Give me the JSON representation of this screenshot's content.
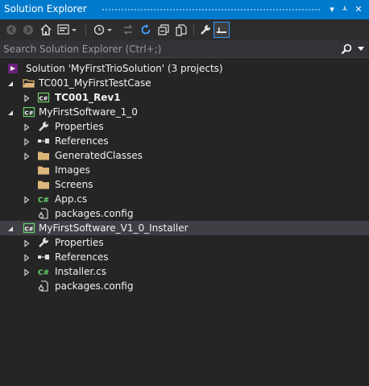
{
  "window": {
    "title": "Solution Explorer"
  },
  "search": {
    "placeholder": "Search Solution Explorer (Ctrl+;)"
  },
  "tree": [
    {
      "label": "Solution 'MyFirstTrioSolution' (3 projects)",
      "icon": "solution-icon",
      "expander": "none"
    },
    {
      "label": "TC001_MyFirstTestCase",
      "icon": "folder-open-icon",
      "expander": "expanded"
    },
    {
      "label": "TC001_Rev1",
      "icon": "csharp-project-icon",
      "expander": "collapsed",
      "bold": true
    },
    {
      "label": "MyFirstSoftware_1_0",
      "icon": "csharp-project-icon",
      "expander": "expanded"
    },
    {
      "label": "Properties",
      "icon": "wrench-icon",
      "expander": "collapsed"
    },
    {
      "label": "References",
      "icon": "references-icon",
      "expander": "collapsed"
    },
    {
      "label": "GeneratedClasses",
      "icon": "folder-icon",
      "expander": "collapsed"
    },
    {
      "label": "Images",
      "icon": "folder-icon",
      "expander": "none"
    },
    {
      "label": "Screens",
      "icon": "folder-icon",
      "expander": "none"
    },
    {
      "label": "App.cs",
      "icon": "csharp-file-icon",
      "expander": "collapsed"
    },
    {
      "label": "packages.config",
      "icon": "config-file-icon",
      "expander": "none"
    },
    {
      "label": "MyFirstSoftware_V1_0_Installer",
      "icon": "csharp-project-icon",
      "expander": "expanded",
      "selected": true
    },
    {
      "label": "Properties",
      "icon": "wrench-icon",
      "expander": "collapsed"
    },
    {
      "label": "References",
      "icon": "references-icon",
      "expander": "collapsed"
    },
    {
      "label": "Installer.cs",
      "icon": "csharp-file-icon",
      "expander": "collapsed"
    },
    {
      "label": "packages.config",
      "icon": "config-file-icon",
      "expander": "none"
    }
  ],
  "colors": {
    "accent": "#007acc",
    "background": "#252526",
    "selected_row": "#3f3f46",
    "folder": "#dcb67a",
    "csharp": "#68d46d"
  }
}
